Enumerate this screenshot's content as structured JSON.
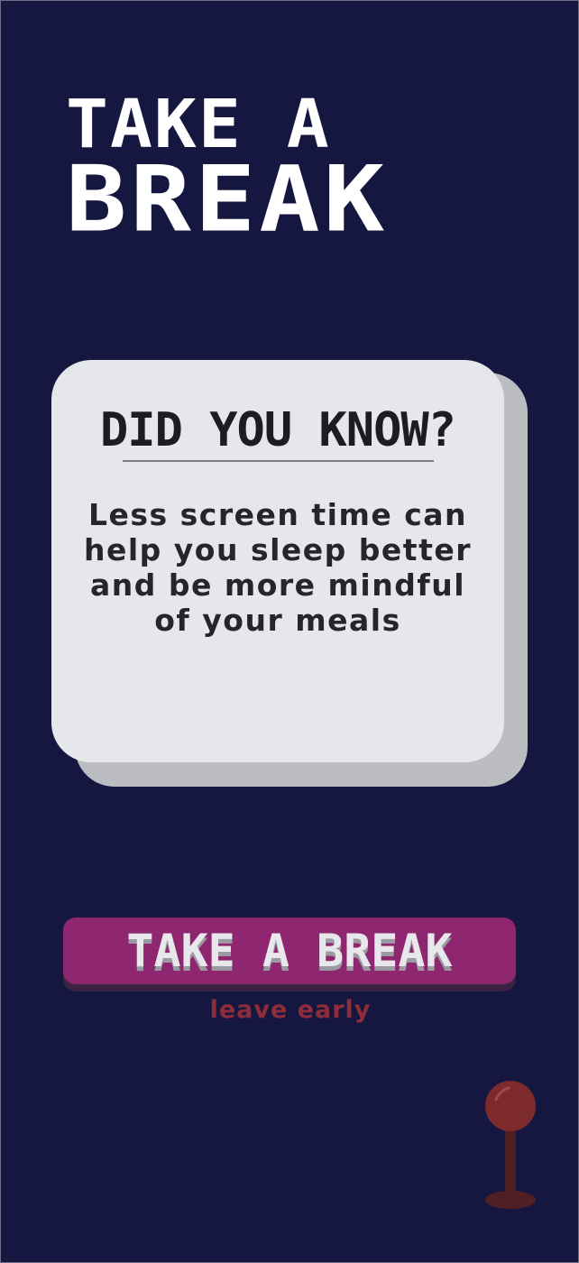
{
  "header": {
    "title_line1": "TAKE A",
    "title_line2": "BREAK"
  },
  "fact_card": {
    "heading": "DID YOU KNOW?",
    "body": "Less screen time can help you sleep better and be more mindful of your meals"
  },
  "actions": {
    "primary_label": "TAKE A BREAK",
    "secondary_label": "leave early"
  },
  "icons": {
    "joystick": "joystick-icon"
  },
  "colors": {
    "background": "#151741",
    "card": "#e6e7ea",
    "card_shadow": "#bcbdc1",
    "primary_button": "#8f2670",
    "leave_link": "#8e2d39",
    "joystick_ball": "#7d2a2c",
    "joystick_stick": "#4f1f24"
  }
}
